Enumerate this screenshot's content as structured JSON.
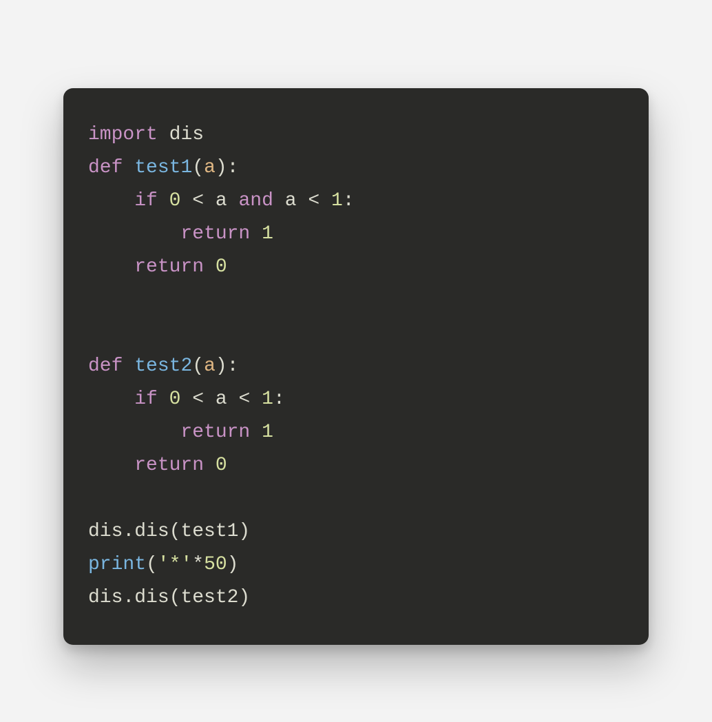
{
  "code": {
    "language": "python",
    "tokens": [
      [
        {
          "t": "import",
          "c": "tok-keyword"
        },
        {
          "t": " ",
          "c": "tok-default"
        },
        {
          "t": "dis",
          "c": "tok-default"
        }
      ],
      [
        {
          "t": "def",
          "c": "tok-keyword"
        },
        {
          "t": " ",
          "c": "tok-default"
        },
        {
          "t": "test1",
          "c": "tok-fname"
        },
        {
          "t": "(",
          "c": "tok-default"
        },
        {
          "t": "a",
          "c": "tok-param"
        },
        {
          "t": "):",
          "c": "tok-default"
        }
      ],
      [
        {
          "t": "    ",
          "c": "tok-default"
        },
        {
          "t": "if",
          "c": "tok-keyword"
        },
        {
          "t": " ",
          "c": "tok-default"
        },
        {
          "t": "0",
          "c": "tok-number"
        },
        {
          "t": " ",
          "c": "tok-default"
        },
        {
          "t": "<",
          "c": "tok-op"
        },
        {
          "t": " a ",
          "c": "tok-default"
        },
        {
          "t": "and",
          "c": "tok-keyword"
        },
        {
          "t": " a ",
          "c": "tok-default"
        },
        {
          "t": "<",
          "c": "tok-op"
        },
        {
          "t": " ",
          "c": "tok-default"
        },
        {
          "t": "1",
          "c": "tok-number"
        },
        {
          "t": ":",
          "c": "tok-default"
        }
      ],
      [
        {
          "t": "        ",
          "c": "tok-default"
        },
        {
          "t": "return",
          "c": "tok-keyword"
        },
        {
          "t": " ",
          "c": "tok-default"
        },
        {
          "t": "1",
          "c": "tok-number"
        }
      ],
      [
        {
          "t": "    ",
          "c": "tok-default"
        },
        {
          "t": "return",
          "c": "tok-keyword"
        },
        {
          "t": " ",
          "c": "tok-default"
        },
        {
          "t": "0",
          "c": "tok-number"
        }
      ],
      [],
      [],
      [
        {
          "t": "def",
          "c": "tok-keyword"
        },
        {
          "t": " ",
          "c": "tok-default"
        },
        {
          "t": "test2",
          "c": "tok-fname"
        },
        {
          "t": "(",
          "c": "tok-default"
        },
        {
          "t": "a",
          "c": "tok-param"
        },
        {
          "t": "):",
          "c": "tok-default"
        }
      ],
      [
        {
          "t": "    ",
          "c": "tok-default"
        },
        {
          "t": "if",
          "c": "tok-keyword"
        },
        {
          "t": " ",
          "c": "tok-default"
        },
        {
          "t": "0",
          "c": "tok-number"
        },
        {
          "t": " ",
          "c": "tok-default"
        },
        {
          "t": "<",
          "c": "tok-op"
        },
        {
          "t": " a ",
          "c": "tok-default"
        },
        {
          "t": "<",
          "c": "tok-op"
        },
        {
          "t": " ",
          "c": "tok-default"
        },
        {
          "t": "1",
          "c": "tok-number"
        },
        {
          "t": ":",
          "c": "tok-default"
        }
      ],
      [
        {
          "t": "        ",
          "c": "tok-default"
        },
        {
          "t": "return",
          "c": "tok-keyword"
        },
        {
          "t": " ",
          "c": "tok-default"
        },
        {
          "t": "1",
          "c": "tok-number"
        }
      ],
      [
        {
          "t": "    ",
          "c": "tok-default"
        },
        {
          "t": "return",
          "c": "tok-keyword"
        },
        {
          "t": " ",
          "c": "tok-default"
        },
        {
          "t": "0",
          "c": "tok-number"
        }
      ],
      [],
      [
        {
          "t": "dis.dis(test1)",
          "c": "tok-default"
        }
      ],
      [
        {
          "t": "print",
          "c": "tok-func"
        },
        {
          "t": "(",
          "c": "tok-default"
        },
        {
          "t": "'*'",
          "c": "tok-string"
        },
        {
          "t": "*",
          "c": "tok-op"
        },
        {
          "t": "50",
          "c": "tok-number"
        },
        {
          "t": ")",
          "c": "tok-default"
        }
      ],
      [
        {
          "t": "dis.dis(test2)",
          "c": "tok-default"
        }
      ]
    ],
    "plain": "import dis\ndef test1(a):\n    if 0 < a and a < 1:\n        return 1\n    return 0\n\n\ndef test2(a):\n    if 0 < a < 1:\n        return 1\n    return 0\n\ndis.dis(test1)\nprint('*'*50)\ndis.dis(test2)"
  },
  "colors": {
    "background_page": "#f3f3f3",
    "background_card": "#2a2a28",
    "text_default": "#dcdccf",
    "keyword": "#c993c6",
    "fname": "#7ab6e0",
    "param": "#e0b783",
    "number": "#d6e0a0",
    "string": "#d6e0a0"
  }
}
